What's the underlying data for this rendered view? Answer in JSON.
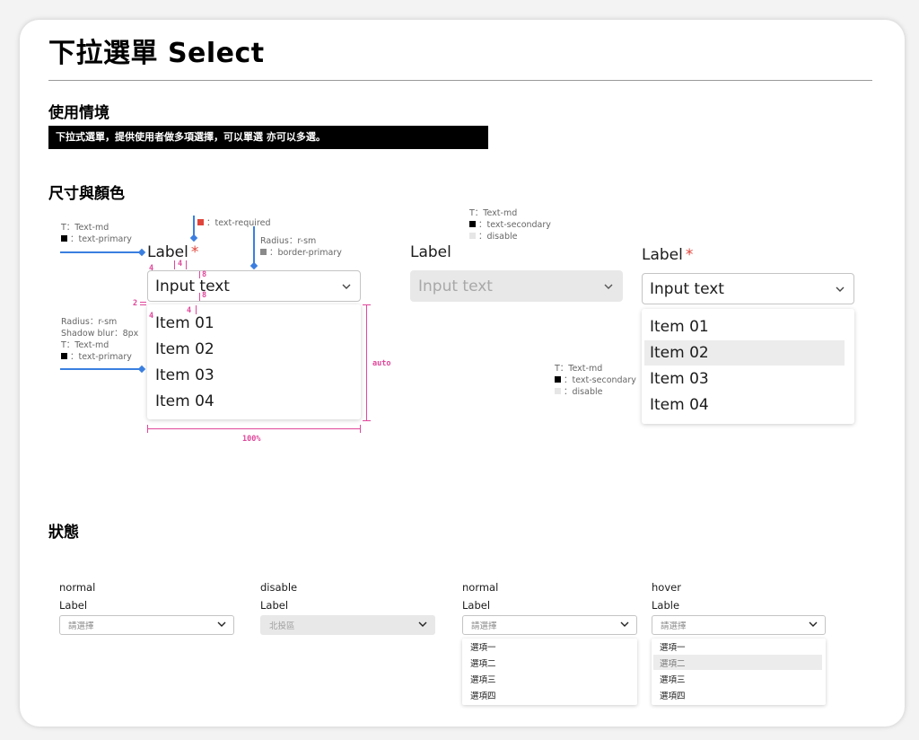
{
  "title": "下拉選單 Select",
  "usage": {
    "heading": "使用情境",
    "description": "下拉式選單，提供使用者做多項選擇，可以單選 亦可以多選。"
  },
  "size_color": {
    "heading": "尺寸與顏色",
    "notes": {
      "label_t": "T：Text-md",
      "label_color": "：text-primary",
      "required": "：text-required",
      "radius": "Radius：r-sm",
      "border": "：border-primary",
      "disabled_t": "T：Text-md",
      "disabled_secondary": "：text-secondary",
      "disabled_disable": "：disable",
      "list_radius": "Radius：r-sm",
      "list_shadow": "Shadow blur：8px",
      "list_t": "T：Text-md",
      "list_color": "：text-primary",
      "hover_t": "T：Text-md",
      "hover_secondary": "：text-secondary",
      "hover_disable": "：disable"
    },
    "dims": {
      "d4a": "4",
      "d4b": "4",
      "d8a": "8",
      "d8b": "8",
      "d2": "2",
      "d4c": "4",
      "d4d": "4",
      "auto": "auto",
      "full": "100%"
    },
    "required_mark": "*",
    "example1": {
      "label": "Label",
      "value": "Input  text",
      "items": [
        "Item 01",
        "Item 02",
        "Item 03",
        "Item 04"
      ]
    },
    "example2": {
      "label": "Label",
      "value": "Input  text"
    },
    "example3": {
      "label": "Label",
      "value": "Input  text",
      "items": [
        "Item 01",
        "Item 02",
        "Item 03",
        "Item 04"
      ],
      "hovered_index": 1
    }
  },
  "states": {
    "heading": "狀態",
    "s1": {
      "state": "normal",
      "label": "Label",
      "placeholder": "請選擇"
    },
    "s2": {
      "state": "disable",
      "label": "Label",
      "placeholder": "北投區"
    },
    "s3": {
      "state": "normal",
      "label": "Label",
      "placeholder": "請選擇",
      "items": [
        "選項一",
        "選項二",
        "選項三",
        "選項四"
      ]
    },
    "s4": {
      "state": "hover",
      "label": "Lable",
      "placeholder": "請選擇",
      "items": [
        "選項一",
        "選項二",
        "選項三",
        "選項四"
      ],
      "hovered_index": 1
    }
  },
  "colors": {
    "text_primary": "#000000",
    "text_required": "#e0453b",
    "border_primary": "#8a8a8a",
    "disable": "#e8e8e8",
    "hover_bg": "#ececec",
    "annotation_blue": "#3a7fe0",
    "dimension_pink": "#e0479b"
  }
}
